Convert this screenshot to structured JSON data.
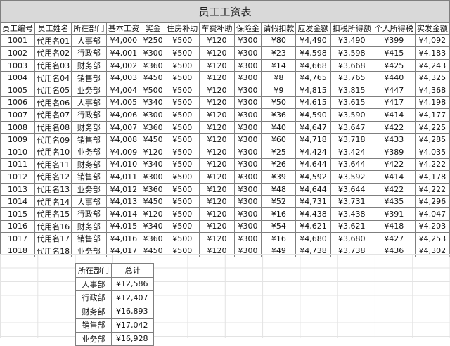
{
  "title": "员工工资表",
  "headers": [
    "员工编号",
    "员工姓名",
    "所在部门",
    "基本工资",
    "奖金",
    "住房补助",
    "车费补助",
    "保险金",
    "请假扣款",
    "应发金额",
    "扣税所得额",
    "个人所得税",
    "实发金额"
  ],
  "rows": [
    [
      "1001",
      "代用名01",
      "人事部",
      "¥4,000",
      "¥250",
      "¥500",
      "¥120",
      "¥300",
      "¥80",
      "¥4,490",
      "¥3,490",
      "¥399",
      "¥4,092"
    ],
    [
      "1002",
      "代用名02",
      "行政部",
      "¥4,001",
      "¥300",
      "¥500",
      "¥120",
      "¥300",
      "¥23",
      "¥4,598",
      "¥3,598",
      "¥415",
      "¥4,183"
    ],
    [
      "1003",
      "代用名03",
      "财务部",
      "¥4,002",
      "¥360",
      "¥500",
      "¥120",
      "¥300",
      "¥14",
      "¥4,668",
      "¥3,668",
      "¥425",
      "¥4,243"
    ],
    [
      "1004",
      "代用名04",
      "销售部",
      "¥4,003",
      "¥450",
      "¥500",
      "¥120",
      "¥300",
      "¥8",
      "¥4,765",
      "¥3,765",
      "¥440",
      "¥4,325"
    ],
    [
      "1005",
      "代用名05",
      "业务部",
      "¥4,004",
      "¥500",
      "¥500",
      "¥120",
      "¥300",
      "¥9",
      "¥4,815",
      "¥3,815",
      "¥447",
      "¥4,368"
    ],
    [
      "1006",
      "代用名06",
      "人事部",
      "¥4,005",
      "¥340",
      "¥500",
      "¥120",
      "¥300",
      "¥50",
      "¥4,615",
      "¥3,615",
      "¥417",
      "¥4,198"
    ],
    [
      "1007",
      "代用名07",
      "行政部",
      "¥4,006",
      "¥300",
      "¥500",
      "¥120",
      "¥300",
      "¥36",
      "¥4,590",
      "¥3,590",
      "¥414",
      "¥4,177"
    ],
    [
      "1008",
      "代用名08",
      "财务部",
      "¥4,007",
      "¥360",
      "¥500",
      "¥120",
      "¥300",
      "¥40",
      "¥4,647",
      "¥3,647",
      "¥422",
      "¥4,225"
    ],
    [
      "1009",
      "代用名09",
      "销售部",
      "¥4,008",
      "¥450",
      "¥500",
      "¥120",
      "¥300",
      "¥60",
      "¥4,718",
      "¥3,718",
      "¥433",
      "¥4,285"
    ],
    [
      "1010",
      "代用名10",
      "业务部",
      "¥4,009",
      "¥120",
      "¥500",
      "¥120",
      "¥300",
      "¥25",
      "¥4,424",
      "¥3,424",
      "¥389",
      "¥4,035"
    ],
    [
      "1011",
      "代用名11",
      "财务部",
      "¥4,010",
      "¥340",
      "¥500",
      "¥120",
      "¥300",
      "¥26",
      "¥4,644",
      "¥3,644",
      "¥422",
      "¥4,222"
    ],
    [
      "1012",
      "代用名12",
      "销售部",
      "¥4,011",
      "¥300",
      "¥500",
      "¥120",
      "¥300",
      "¥39",
      "¥4,592",
      "¥3,592",
      "¥414",
      "¥4,178"
    ],
    [
      "1013",
      "代用名13",
      "业务部",
      "¥4,012",
      "¥360",
      "¥500",
      "¥120",
      "¥300",
      "¥48",
      "¥4,644",
      "¥3,644",
      "¥422",
      "¥4,222"
    ],
    [
      "1014",
      "代用名14",
      "人事部",
      "¥4,013",
      "¥450",
      "¥500",
      "¥120",
      "¥300",
      "¥52",
      "¥4,731",
      "¥3,731",
      "¥435",
      "¥4,296"
    ],
    [
      "1015",
      "代用名15",
      "行政部",
      "¥4,014",
      "¥120",
      "¥500",
      "¥120",
      "¥300",
      "¥16",
      "¥4,438",
      "¥3,438",
      "¥391",
      "¥4,047"
    ],
    [
      "1016",
      "代用名16",
      "财务部",
      "¥4,015",
      "¥340",
      "¥500",
      "¥120",
      "¥300",
      "¥54",
      "¥4,621",
      "¥3,621",
      "¥418",
      "¥4,203"
    ],
    [
      "1017",
      "代用名17",
      "销售部",
      "¥4,016",
      "¥360",
      "¥500",
      "¥120",
      "¥300",
      "¥16",
      "¥4,680",
      "¥3,680",
      "¥427",
      "¥4,253"
    ],
    [
      "1018",
      "代用名18",
      "业务部",
      "¥4,017",
      "¥450",
      "¥500",
      "¥120",
      "¥300",
      "¥49",
      "¥4,738",
      "¥3,738",
      "¥436",
      "¥4,302"
    ]
  ],
  "summary": {
    "headers": [
      "所在部门",
      "总计"
    ],
    "rows": [
      [
        "人事部",
        "¥12,586"
      ],
      [
        "行政部",
        "¥12,407"
      ],
      [
        "财务部",
        "¥16,893"
      ],
      [
        "销售部",
        "¥17,042"
      ],
      [
        "业务部",
        "¥16,928"
      ]
    ]
  }
}
